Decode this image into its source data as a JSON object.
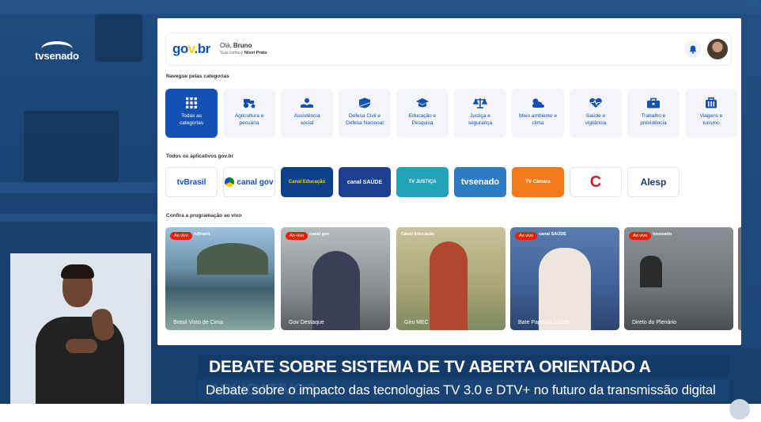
{
  "broadcast": {
    "logo": "tvsenado",
    "headline": "DEBATE SOBRE SISTEMA DE TV ABERTA ORIENTADO A APLICATIVOS",
    "subheadline": "Debate sobre o impacto das tecnologias TV 3.0 e DTV+ no futuro da transmissão digital"
  },
  "header": {
    "brand_parts": [
      "go",
      "v",
      ".",
      "br"
    ],
    "greeting_prefix": "Olá,",
    "user_name": "Bruno",
    "account_prefix": "Sua conta é",
    "account_level": "Nível Prata",
    "bell_icon": "bell-icon",
    "avatar_icon": "user-avatar"
  },
  "categories": {
    "title": "Navegue pelas categorias",
    "items": [
      {
        "label": "Todas as\ncategorias",
        "icon": "grid-icon",
        "active": true
      },
      {
        "label": "Agricultura e\npecuária",
        "icon": "tractor-icon",
        "active": false
      },
      {
        "label": "Assistência\nsocial",
        "icon": "hands-icon",
        "active": false
      },
      {
        "label": "Defesa Civil e\nDefesa Nacional",
        "icon": "shield-icon",
        "active": false
      },
      {
        "label": "Educação e\nPesquisa",
        "icon": "graduation-cap-icon",
        "active": false
      },
      {
        "label": "Justiça e\nsegurança",
        "icon": "scales-icon",
        "active": false
      },
      {
        "label": "Meio ambiente e\nclima",
        "icon": "cloud-sun-icon",
        "active": false
      },
      {
        "label": "Saúde e\nvigilância",
        "icon": "heart-pulse-icon",
        "active": false
      },
      {
        "label": "Trabalho e\nprevidência",
        "icon": "briefcase-icon",
        "active": false
      },
      {
        "label": "Viagens e\nturismo",
        "icon": "luggage-icon",
        "active": false
      }
    ]
  },
  "apps": {
    "title": "Todos os aplicativos gov.br",
    "items": [
      {
        "label": "tvBrasil",
        "bg": "#ffffff",
        "fg": "#1351b4"
      },
      {
        "label": "canal gov",
        "bg": "#ffffff",
        "fg": "#1351b4"
      },
      {
        "label": "Canal Educação",
        "bg": "#0c3f8c",
        "fg": "#ffd200"
      },
      {
        "label": "canal SAÚDE",
        "bg": "#1e3f8f",
        "fg": "#ffffff"
      },
      {
        "label": "TV JUSTIÇA",
        "bg": "#22a3b8",
        "fg": "#ffffff"
      },
      {
        "label": "tvsenado",
        "bg": "#2e7cc3",
        "fg": "#ffffff"
      },
      {
        "label": "TV Câmara",
        "bg": "#f07a1c",
        "fg": "#ffffff"
      },
      {
        "label": "C",
        "bg": "#ffffff",
        "fg": "#c8202b"
      },
      {
        "label": "Alesp",
        "bg": "#ffffff",
        "fg": "#1b3b6f"
      }
    ]
  },
  "live": {
    "title": "Confira a programação ao vivo",
    "badge": "Ao vivo",
    "tiles": [
      {
        "caption": "Brasil Visto de Cima",
        "channel": "tvBrasil",
        "bg": "#6b8fa8"
      },
      {
        "caption": "Gov Destaque",
        "channel": "canal gov",
        "bg": "#8a8e92"
      },
      {
        "caption": "Giro MEC",
        "channel": "Canal Educação",
        "bg": "#a8a474"
      },
      {
        "caption": "Bate Papo na Saúde",
        "channel": "canal SAÚDE",
        "bg": "#3d5f93"
      },
      {
        "caption": "Direto do Plenário",
        "channel": "tvsenado",
        "bg": "#6f7478"
      }
    ]
  }
}
